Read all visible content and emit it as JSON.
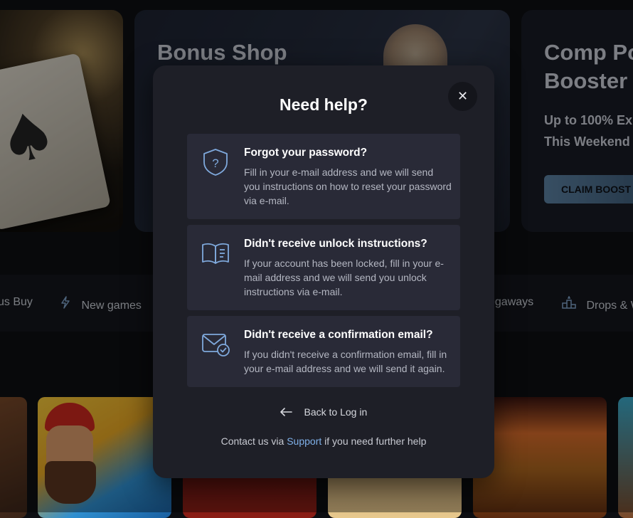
{
  "banners": {
    "bonus_shop_title": "Bonus Shop",
    "comp_title_line1": "Comp Po",
    "comp_title_line2": "Booster ...",
    "comp_sub_line1": "Up to 100% Ex",
    "comp_sub_line2": "This Weekend",
    "claim_label": "CLAIM BOOST"
  },
  "categories": [
    {
      "label": "us Buy"
    },
    {
      "label": "New games"
    },
    {
      "label": "egaways"
    },
    {
      "label": "Drops & W"
    }
  ],
  "modal": {
    "title": "Need help?",
    "close_symbol": "✕",
    "options": [
      {
        "heading": "Forgot your password?",
        "desc": "Fill in your e-mail address and we will send you instructions on how to reset your password via e-mail."
      },
      {
        "heading": "Didn't receive unlock instructions?",
        "desc": "If your account has been locked, fill in your e-mail address and we will send you unlock instructions via e-mail."
      },
      {
        "heading": "Didn't receive a confirmation email?",
        "desc": "If you didn't receive a confirmation email, fill in your e-mail address and we will send it again."
      }
    ],
    "back_label": "Back to Log in",
    "help_prefix": "Contact us via",
    "help_link": "Support",
    "help_suffix": "if you need further help"
  },
  "colors": {
    "modal_bg": "#1e1f27",
    "option_bg": "#292a37",
    "icon_accent": "#7fa9dc",
    "link": "#7fb0e8"
  },
  "icons": [
    "shield-question-icon",
    "open-book-icon",
    "envelope-check-icon",
    "arrow-left-icon",
    "close-icon",
    "lightning-icon",
    "podium-icon"
  ]
}
